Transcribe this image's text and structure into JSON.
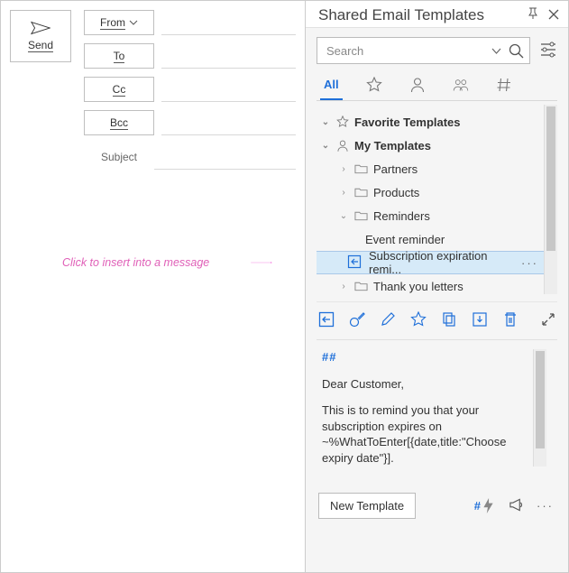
{
  "compose": {
    "send": "Send",
    "from": "From",
    "to": "To",
    "cc": "Cc",
    "bcc": "Bcc",
    "subject": "Subject"
  },
  "callout": "Click to insert into a message",
  "panel": {
    "title": "Shared Email Templates",
    "search_placeholder": "Search",
    "tabs": {
      "all": "All"
    },
    "tree": {
      "favorite": "Favorite Templates",
      "my": "My Templates",
      "partners": "Partners",
      "products": "Products",
      "reminders": "Reminders",
      "event": "Event reminder",
      "sub_expire": "Subscription expiration remi...",
      "thanks": "Thank you letters"
    },
    "preview": {
      "hash": "##",
      "greeting": "Dear Customer,",
      "body": "This is to remind you that your subscription expires on ~%WhatToEnter[{date,title:\"Choose expiry date\"}]."
    },
    "new_btn": "New Template"
  }
}
